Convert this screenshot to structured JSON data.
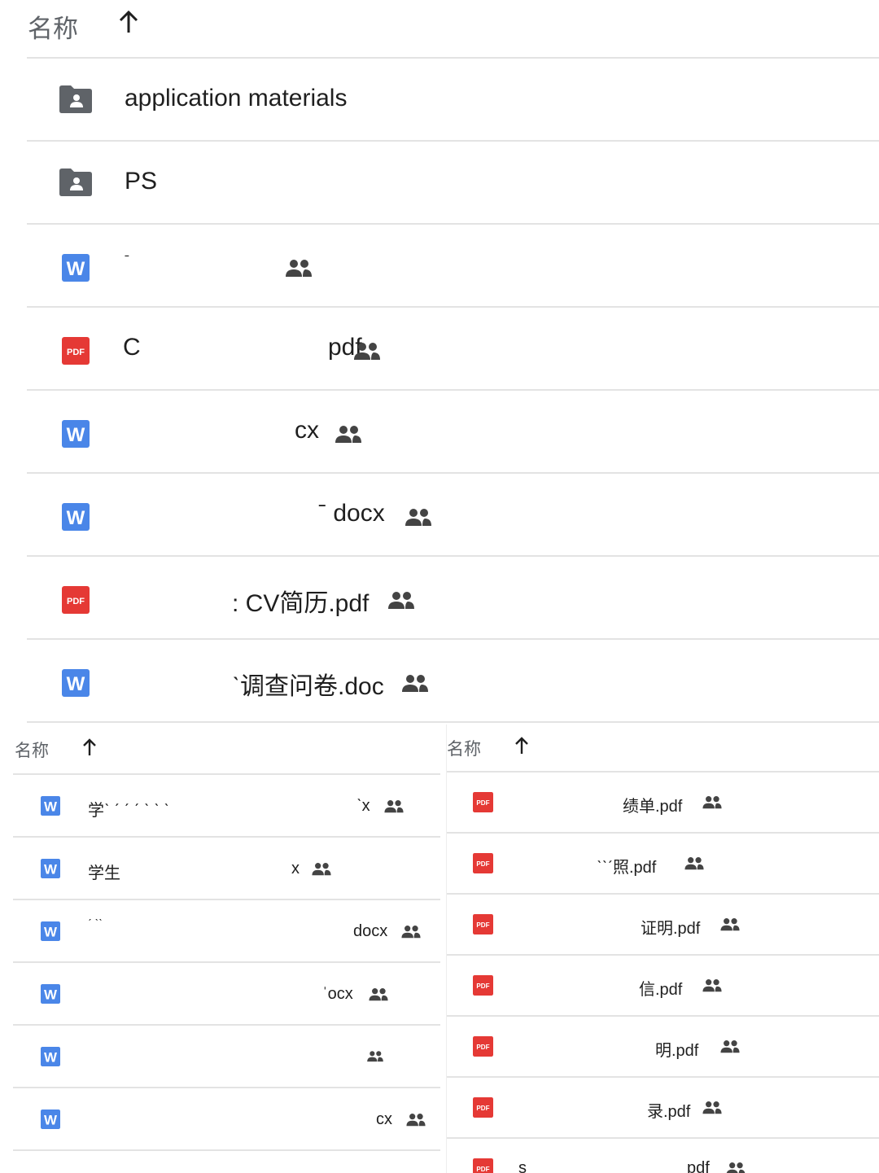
{
  "main_panel": {
    "header": {
      "name_label": "名称",
      "sort_arrow": "up-arrow-icon"
    },
    "rows": [
      {
        "type": "folder",
        "icon": "shared-folder-icon",
        "name": "application materials",
        "shared": false
      },
      {
        "type": "folder",
        "icon": "shared-folder-icon",
        "name": "PS",
        "shared": false
      },
      {
        "type": "word",
        "icon": "word-doc-icon",
        "name": "ˉ",
        "shared": true
      },
      {
        "type": "pdf",
        "icon": "pdf-icon",
        "name": "C",
        "suffix": "pdf",
        "shared": true
      },
      {
        "type": "word",
        "icon": "word-doc-icon",
        "name": "",
        "suffix": "cx",
        "shared": true
      },
      {
        "type": "word",
        "icon": "word-doc-icon",
        "name": "",
        "suffix": "ˉ docx",
        "shared": true
      },
      {
        "type": "pdf",
        "icon": "pdf-icon",
        "name": "",
        "suffix": ": CV简历.pdf",
        "shared": true
      },
      {
        "type": "word",
        "icon": "word-doc-icon",
        "name": "",
        "suffix": "ˋ调查问卷.doc",
        "shared": true
      }
    ]
  },
  "left_panel": {
    "header": {
      "name_label": "名称",
      "sort_arrow": "up-arrow-icon"
    },
    "rows": [
      {
        "type": "word",
        "icon": "word-doc-icon",
        "name": "学ˋ ˊ ˊ ˊ ˋ ˋ ˋ",
        "suffix": "ˋx",
        "shared": true
      },
      {
        "type": "word",
        "icon": "word-doc-icon",
        "name": "学生",
        "suffix": "x",
        "shared": true
      },
      {
        "type": "word",
        "icon": "word-doc-icon",
        "name": "ˊ  ˋˋ",
        "suffix": "docx",
        "shared": true
      },
      {
        "type": "word",
        "icon": "word-doc-icon",
        "name": "",
        "suffix": "ˈocx",
        "shared": true
      },
      {
        "type": "word",
        "icon": "word-doc-icon",
        "name": "",
        "suffix": "",
        "shared": true
      },
      {
        "type": "word",
        "icon": "word-doc-icon",
        "name": "",
        "suffix": "cx",
        "shared": true
      }
    ]
  },
  "right_panel": {
    "header": {
      "name_label": "名称",
      "sort_arrow": "up-arrow-icon"
    },
    "rows": [
      {
        "type": "pdf",
        "icon": "pdf-icon",
        "name": "",
        "suffix": "绩单.pdf",
        "shared": true
      },
      {
        "type": "pdf",
        "icon": "pdf-icon",
        "name": "",
        "suffix": "ˋˋˊ照.pdf",
        "shared": true
      },
      {
        "type": "pdf",
        "icon": "pdf-icon",
        "name": "",
        "suffix": "证明.pdf",
        "shared": true
      },
      {
        "type": "pdf",
        "icon": "pdf-icon",
        "name": "",
        "suffix": "信.pdf",
        "shared": true
      },
      {
        "type": "pdf",
        "icon": "pdf-icon",
        "name": "",
        "suffix": "明.pdf",
        "shared": true
      },
      {
        "type": "pdf",
        "icon": "pdf-icon",
        "name": "",
        "suffix": "录.pdf",
        "shared": true
      },
      {
        "type": "pdf",
        "icon": "pdf-icon",
        "name": "s",
        "suffix": "pdf",
        "shared": true
      }
    ]
  },
  "colors": {
    "word_blue": "#4a86e8",
    "pdf_red": "#e53935",
    "folder_gray": "#5f6368",
    "divider": "#e3e3e3"
  }
}
